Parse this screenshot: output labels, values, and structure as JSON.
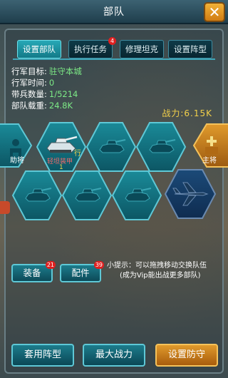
{
  "header": {
    "title": "部队",
    "close_label": "✕"
  },
  "tabs": [
    {
      "label": "设置部队",
      "active": true
    },
    {
      "label": "执行任务",
      "badge": "4"
    },
    {
      "label": "修理坦克"
    },
    {
      "label": "设置阵型"
    }
  ],
  "info": {
    "target_label": "行军目标:",
    "target_value": "驻守本城",
    "time_label": "行军时间:",
    "time_value": "0",
    "troops_label": "带兵数量:",
    "troops_value": "1/5214",
    "load_label": "部队载重:",
    "load_value": "24.8K"
  },
  "power_text": "战力:6.15K",
  "formation": {
    "assistant_label": "助将",
    "main_label": "主将",
    "active_unit_name": "轻坦装甲",
    "active_unit_level": "1",
    "active_unit_tag": "行",
    "slot_icon": "tank-silhouette-icon",
    "aircraft_icon": "fighter-plane-icon"
  },
  "hint": {
    "line1": "小提示：可以拖拽移动交换队伍",
    "line2": "(成为Vip能出战更多部队)"
  },
  "buttons": {
    "equip_label": "装备",
    "equip_badge": "21",
    "parts_label": "配件",
    "parts_badge": "39",
    "apply_formation": "套用阵型",
    "max_power": "最大战力",
    "set_defense": "设置防守"
  },
  "colors": {
    "accent": "#27a8b6",
    "power": "#f2d04a",
    "value": "#7dea86",
    "orange": "#e09a2c"
  }
}
